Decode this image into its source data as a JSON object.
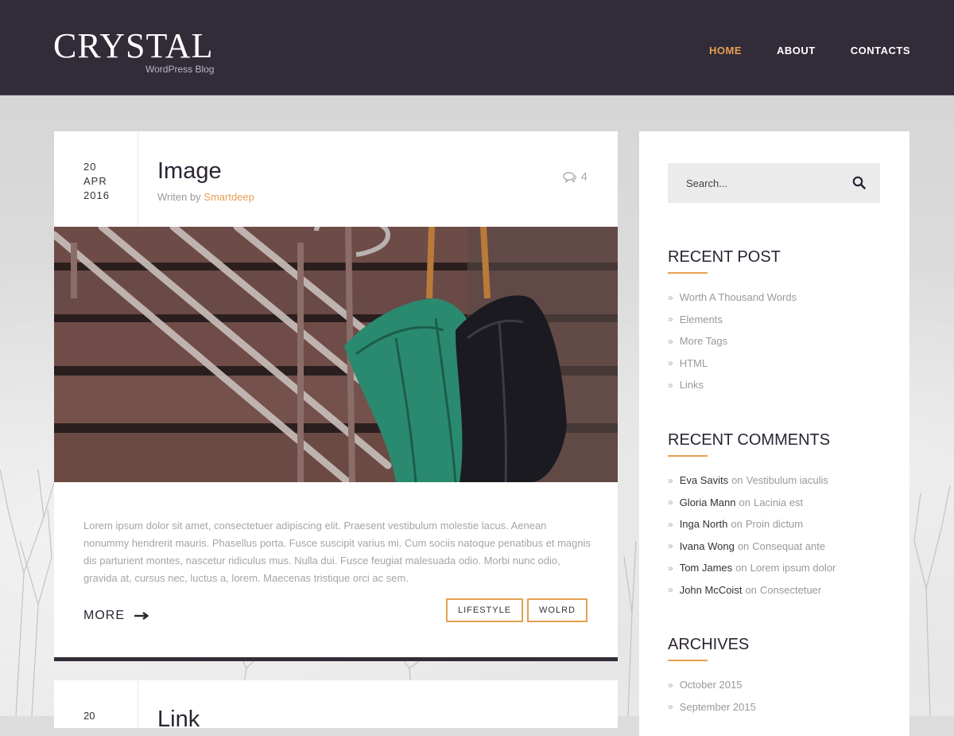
{
  "header": {
    "logo": "CRYSTAL",
    "tagline": "WordPress Blog",
    "nav": [
      "HOME",
      "ABOUT",
      "CONTACTS"
    ],
    "accent": "#e6a052",
    "background": "#322b38"
  },
  "post": {
    "day": "20",
    "month": "APR",
    "year": "2016",
    "title": "Image",
    "byline_prefix": "Writen by",
    "author": "Smartdeep",
    "comment_count": "4",
    "excerpt": "Lorem ipsum dolor sit amet, consectetuer adipiscing elit. Praesent vestibulum molestie lacus. Aenean nonummy hendrerit mauris. Phasellus porta. Fusce suscipit varius mi. Cum sociis natoque penatibus et magnis dis parturient montes, nascetur ridiculus mus. Nulla dui. Fusce feugiat malesuada odio. Morbi nunc odio, gravida at, cursus nec, luctus a, lorem. Maecenas tristique orci ac sem.",
    "more_label": "MORE",
    "tags": [
      "LIFESTYLE",
      "WOLRD"
    ]
  },
  "post2": {
    "day": "20",
    "title": "Link"
  },
  "sidebar": {
    "search_placeholder": "Search...",
    "recent_post_title": "RECENT POST",
    "recent_posts": [
      "Worth A Thousand Words",
      "Elements",
      "More Tags",
      "HTML",
      "Links"
    ],
    "recent_comments_title": "RECENT COMMENTS",
    "comments_on": "on",
    "recent_comments": [
      {
        "author": "Eva Savits",
        "post": "Vestibulum iaculis"
      },
      {
        "author": "Gloria Mann",
        "post": "Lacinia est"
      },
      {
        "author": "Inga North",
        "post": "Proin dictum"
      },
      {
        "author": "Ivana Wong",
        "post": "Consequat ante"
      },
      {
        "author": "Tom James",
        "post": "Lorem ipsum dolor"
      },
      {
        "author": "John McCoist",
        "post": "Consectetuer"
      }
    ],
    "archives_title": "ARCHIVES",
    "archives": [
      "October 2015",
      "September 2015"
    ]
  }
}
